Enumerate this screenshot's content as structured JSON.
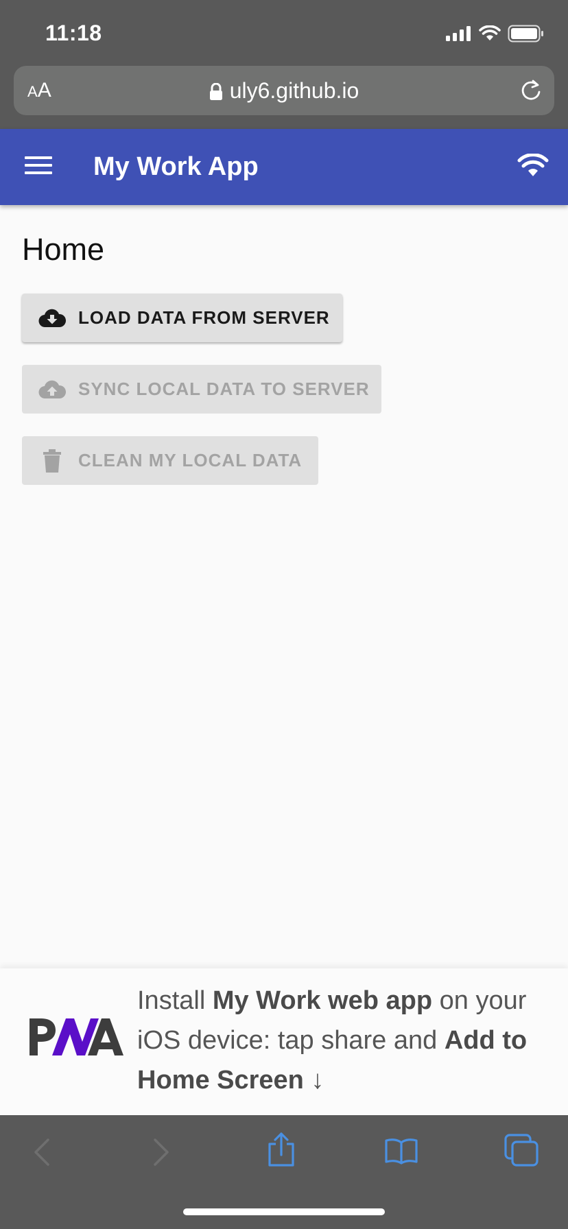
{
  "status_bar": {
    "time": "11:18"
  },
  "browser": {
    "text_size_label_small": "A",
    "text_size_label_large": "A",
    "url": "uly6.github.io"
  },
  "app_bar": {
    "title": "My Work App"
  },
  "page": {
    "title": "Home"
  },
  "actions": {
    "load_label": "LOAD DATA FROM SERVER",
    "sync_label": "SYNC LOCAL DATA TO SERVER",
    "clean_label": "CLEAN MY LOCAL DATA"
  },
  "install_banner": {
    "part1": "Install ",
    "app_name": "My Work web app",
    "part2": " on your iOS device: tap share and ",
    "action": "Add to Home Screen",
    "arrow": " ↓"
  },
  "colors": {
    "app_bar": "#3f51b5",
    "browser_chrome": "#595959",
    "toolbar_active_icon": "#4a90e2",
    "toolbar_disabled_icon": "#6f6f6f",
    "pwa_purple": "#5a0fc8"
  },
  "icons": {
    "status": [
      "signal-icon",
      "wifi-icon",
      "battery-icon"
    ],
    "app_bar": [
      "menu-icon",
      "wifi-icon"
    ],
    "actions": [
      "cloud-download-icon",
      "cloud-upload-icon",
      "trash-icon"
    ],
    "toolbar": [
      "back-icon",
      "forward-icon",
      "share-icon",
      "bookmarks-icon",
      "tabs-icon"
    ]
  }
}
